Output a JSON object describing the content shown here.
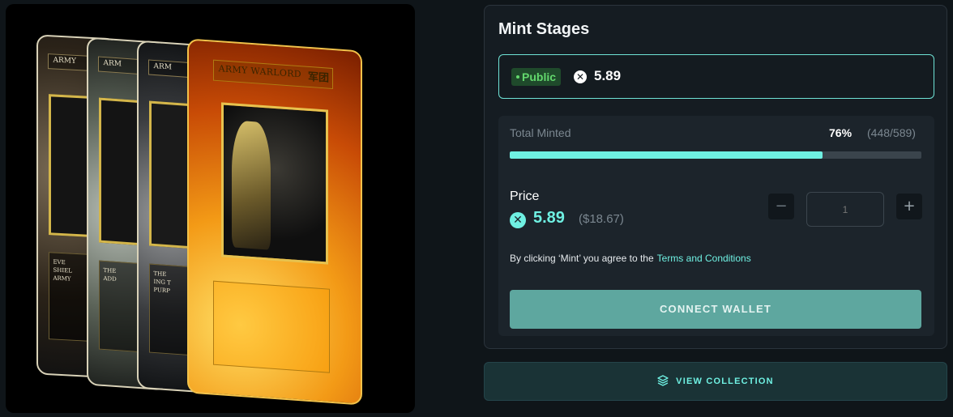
{
  "artwork": {
    "cards": [
      {
        "id": "card-1",
        "title": "ARMY",
        "text": "EVE\nSHIEL\nARMY"
      },
      {
        "id": "card-2",
        "title": "ARM",
        "text": "THE\nADD"
      },
      {
        "id": "card-3",
        "title": "ARM",
        "text": "THE\nING T\nPURP"
      },
      {
        "id": "card-4",
        "title": "ARMY WARLORD",
        "glyph": "军团"
      }
    ]
  },
  "mint": {
    "title": "Mint Stages",
    "stage": {
      "badge": "Public",
      "price": "5.89"
    },
    "total_minted_label": "Total Minted",
    "minted_percent": "76%",
    "minted_count": "(448/589)",
    "minted_fraction": 0.76,
    "price_label": "Price",
    "price": "5.89",
    "price_usd": "($18.67)",
    "quantity_placeholder": "1",
    "minus_label": "−",
    "plus_label": "+",
    "terms_prefix": "By clicking ‘Mint’ you agree to the",
    "terms_link": "Terms and Conditions",
    "connect_label": "CONNECT WALLET",
    "view_collection_label": "VIEW COLLECTION"
  },
  "icons": {
    "currency": "xrp-icon",
    "view_collection": "layers-icon"
  },
  "colors": {
    "accent": "#6ff0e2",
    "button": "#5ea79f",
    "badge_bg": "#1f4a2b",
    "badge_text": "#63d86d"
  }
}
